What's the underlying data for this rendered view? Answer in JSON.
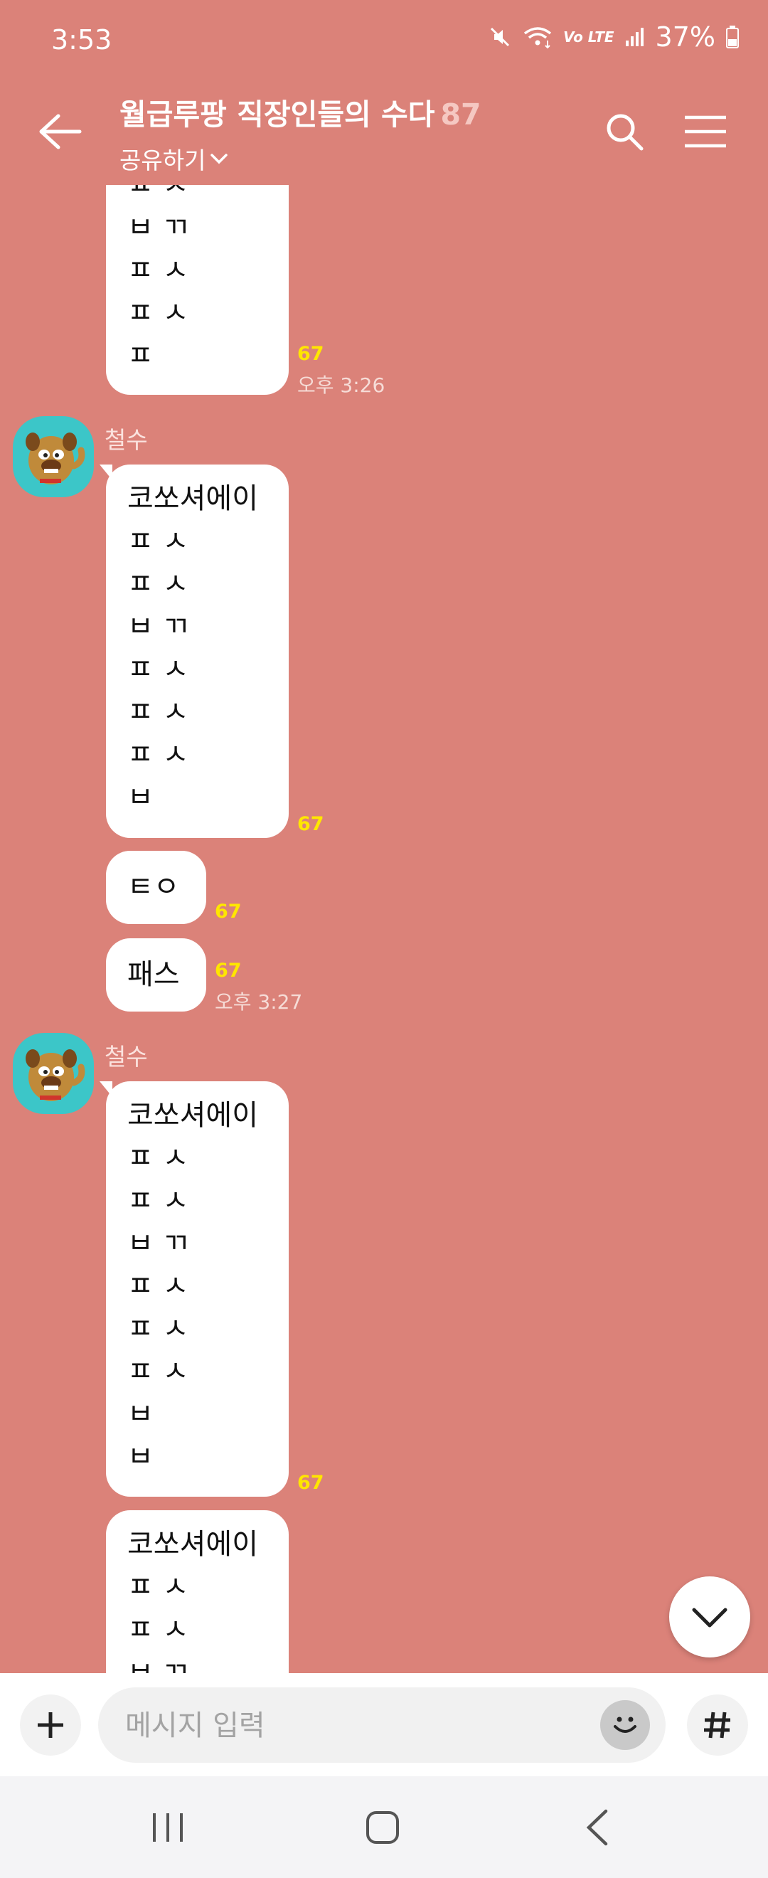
{
  "status_bar": {
    "time": "3:53",
    "network": "Vo LTE",
    "battery": "37%"
  },
  "header": {
    "title": "월급루팡 직장인들의 수다",
    "member_count": "87",
    "share_label": "공유하기"
  },
  "messages": [
    {
      "lines": [
        "ㅍ ㅅ",
        "ㅂ ㄲ",
        "ㅍ ㅅ",
        "ㅍ ㅅ",
        "ㅍ"
      ],
      "unread": "67",
      "time": "오후 3:26"
    },
    {
      "sender": "철수",
      "lines": [
        "코쏘셔에이",
        "ㅍ ㅅ",
        "ㅍ ㅅ",
        "ㅂ ㄲ",
        "ㅍ ㅅ",
        "ㅍ ㅅ",
        "ㅍ ㅅ",
        "ㅂ"
      ],
      "unread": "67"
    },
    {
      "lines": [
        "ㅌㅇ"
      ],
      "unread": "67"
    },
    {
      "lines": [
        "패스"
      ],
      "unread": "67",
      "time": "오후 3:27"
    },
    {
      "sender": "철수",
      "lines": [
        "코쏘셔에이",
        "ㅍ ㅅ",
        "ㅍ ㅅ",
        "ㅂ ㄲ",
        "ㅍ ㅅ",
        "ㅍ ㅅ",
        "ㅍ ㅅ",
        "ㅂ",
        "ㅂ"
      ],
      "unread": "67"
    },
    {
      "lines": [
        "코쏘셔에이",
        "ㅍ ㅅ",
        "ㅍ ㅅ",
        "ㅂ ㄲ"
      ]
    }
  ],
  "input": {
    "placeholder": "메시지 입력"
  },
  "colors": {
    "chat_background": "#db8279",
    "unread_count": "#ffe600",
    "avatar_background": "#3cc6c8"
  }
}
